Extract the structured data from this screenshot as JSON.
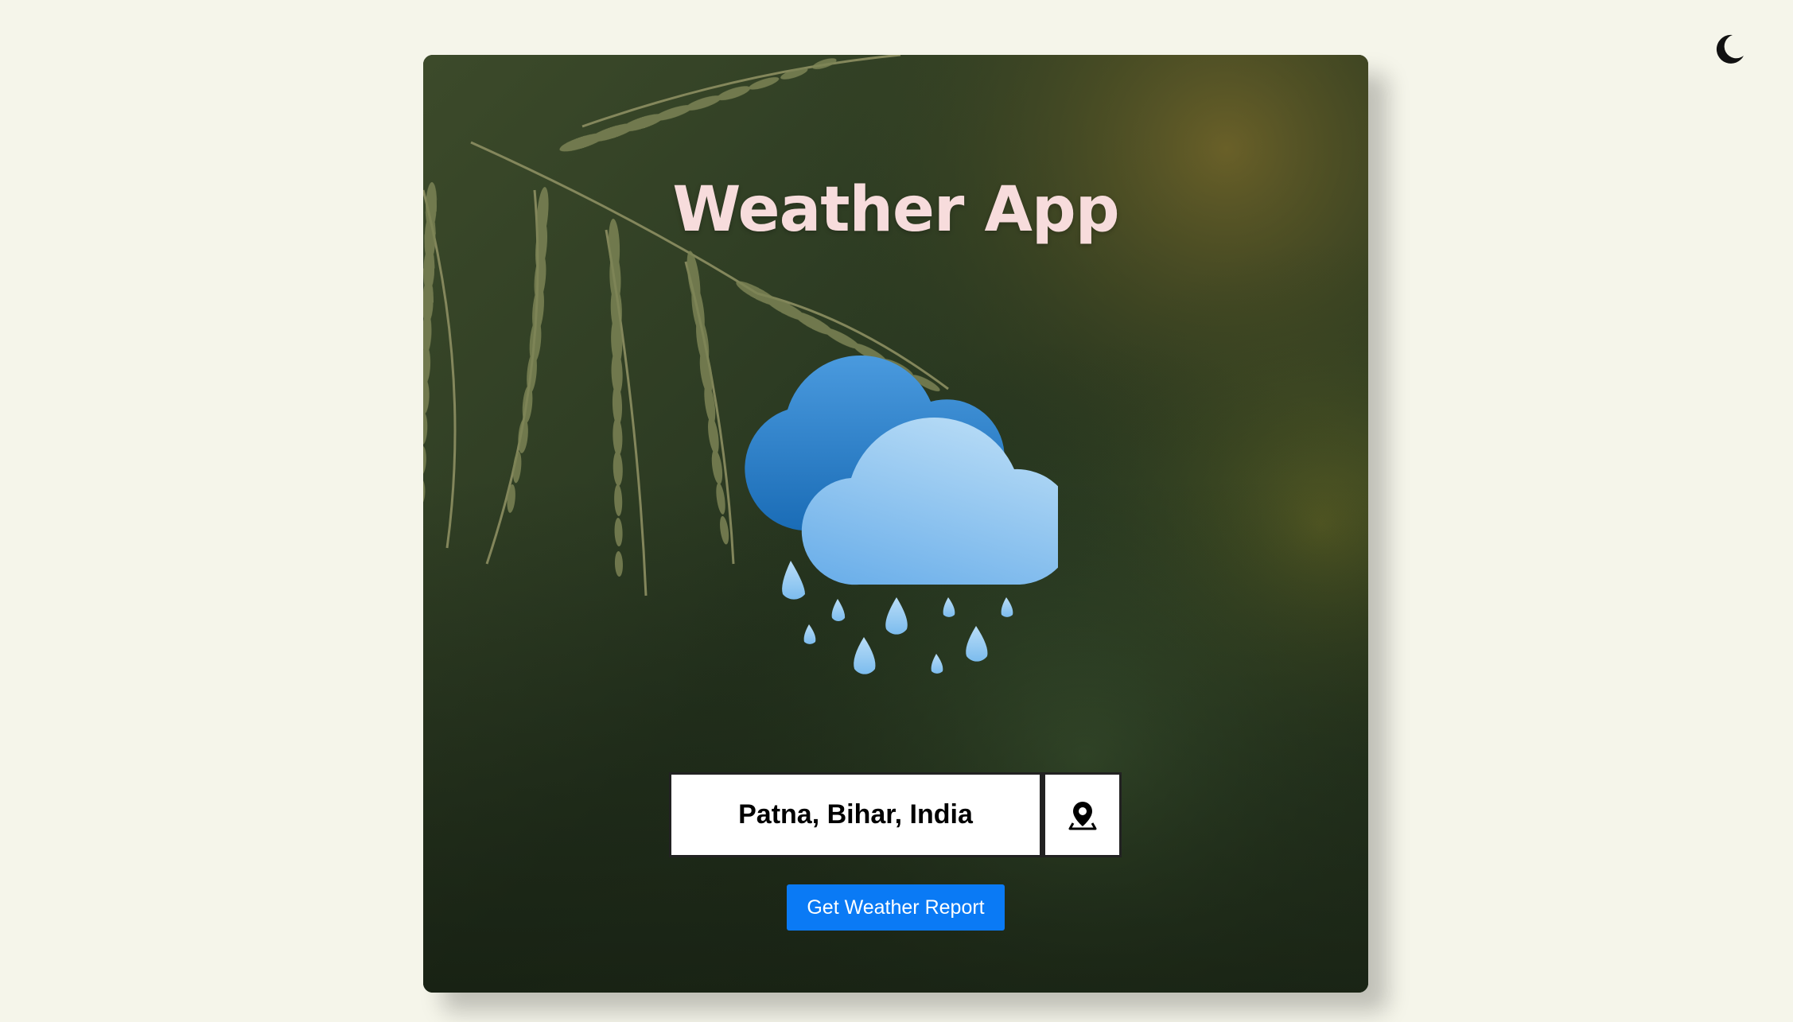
{
  "header": {
    "theme_toggle_icon": "moon-icon"
  },
  "card": {
    "title": "Weather App",
    "weather_icon": "cloud-rain-icon",
    "background": "fern-leaves-photo"
  },
  "search": {
    "location_value": "Patna, Bihar, India",
    "locate_icon": "map-pin-icon"
  },
  "actions": {
    "report_label": "Get Weather Report"
  },
  "colors": {
    "page_bg": "#f5f5ea",
    "title": "#f7dcdc",
    "button_bg": "#0a7af5",
    "button_text": "#ffffff"
  }
}
